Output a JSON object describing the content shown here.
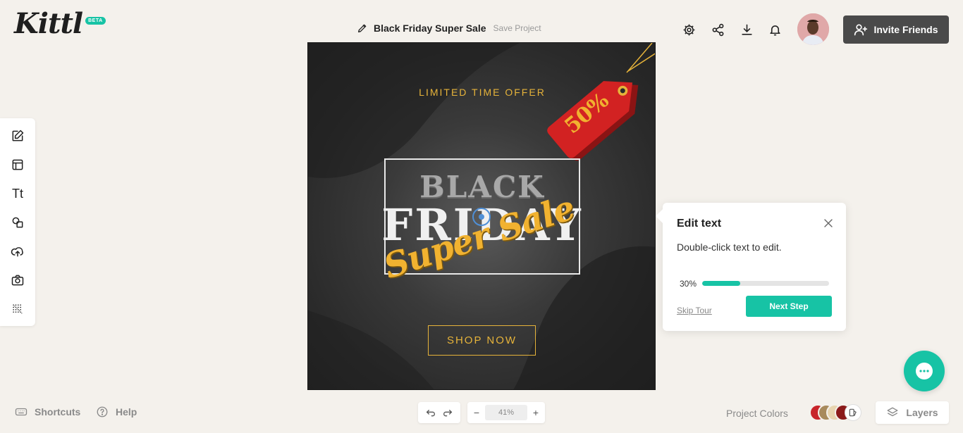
{
  "app": {
    "logo": "Kittl",
    "beta_badge": "BETA"
  },
  "header": {
    "project_title": "Black Friday Super Sale",
    "save_label": "Save Project",
    "invite_label": "Invite Friends",
    "icons": [
      "gear-icon",
      "share-icon",
      "download-icon",
      "bell-icon"
    ]
  },
  "toolbar": {
    "items": [
      "edit-icon",
      "templates-icon",
      "text-icon",
      "shapes-icon",
      "upload-icon",
      "camera-icon",
      "texture-icon"
    ],
    "text_tool_glyph": "Tt"
  },
  "design": {
    "tagline": "LIMITED TIME OFFER",
    "headline_1": "BLACK",
    "headline_2": "FRIDAY",
    "script_text": "Super Sale",
    "tag_text": "50%",
    "cta": "SHOP NOW",
    "colors": {
      "gold": "#e6b33a",
      "red": "#cc1f1f",
      "dark": "#2a2a2a"
    }
  },
  "tour": {
    "title": "Edit text",
    "body": "Double-click text to edit.",
    "progress_label": "30%",
    "progress_value": 0.3,
    "skip_label": "Skip Tour",
    "next_label": "Next Step"
  },
  "footer": {
    "shortcuts_label": "Shortcuts",
    "help_label": "Help",
    "zoom_value": "41%",
    "zoom_minus": "−",
    "zoom_plus": "+",
    "project_colors_label": "Project Colors",
    "swatches": [
      "#c8242a",
      "#a88a5c",
      "#e8d5b0",
      "#8b1a1a"
    ],
    "layers_label": "Layers"
  },
  "accent_color": "#17c3a5"
}
